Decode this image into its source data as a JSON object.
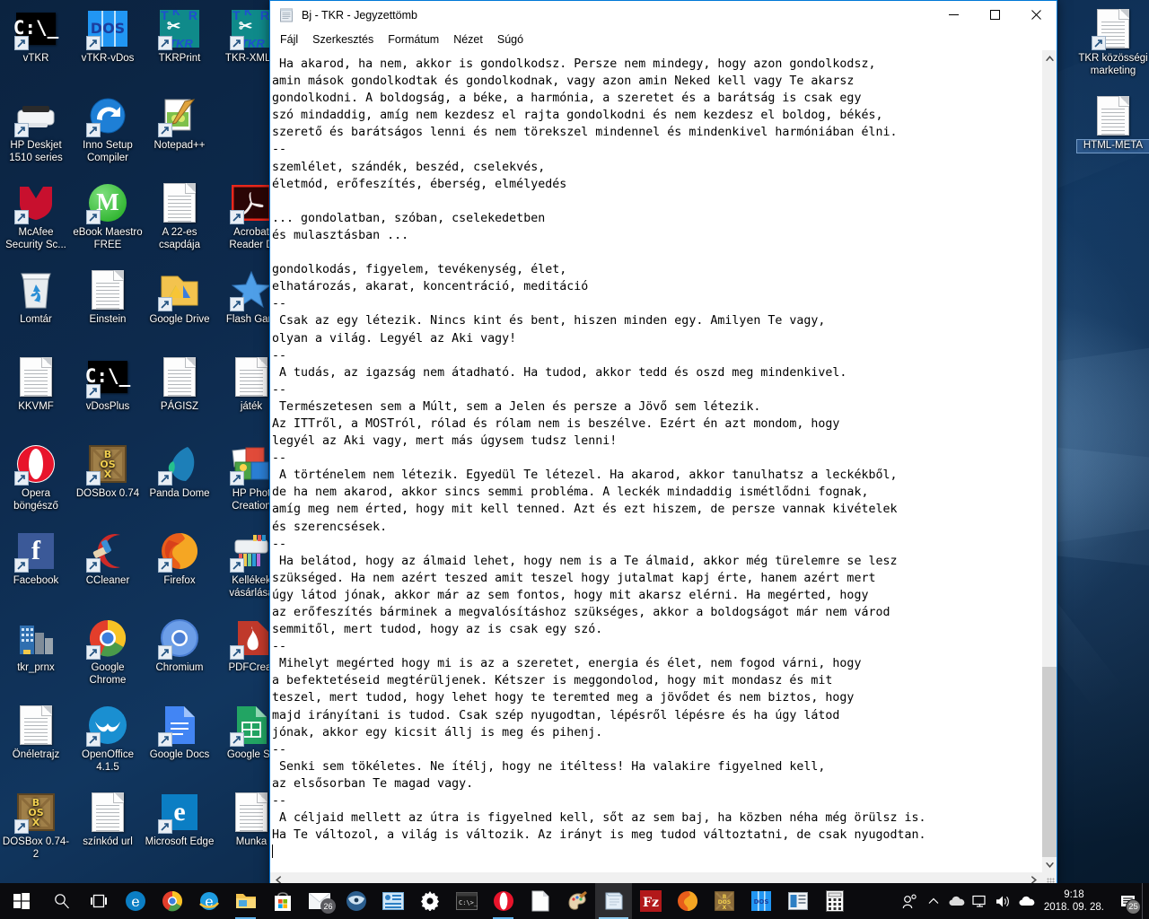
{
  "desktop": {
    "icons": [
      {
        "label": "vTKR",
        "art": "cmd",
        "shortcut": true,
        "col": 0,
        "row": 0
      },
      {
        "label": "vTKR-vDos",
        "art": "dos",
        "shortcut": true,
        "col": 1,
        "row": 0
      },
      {
        "label": "TKRPrint",
        "art": "tkr",
        "shortcut": true,
        "col": 2,
        "row": 0
      },
      {
        "label": "TKR-XMLP",
        "art": "tkr",
        "shortcut": true,
        "col": 3,
        "row": 0
      },
      {
        "label": "HP Deskjet 1510 series",
        "art": "printer",
        "shortcut": true,
        "col": 0,
        "row": 1
      },
      {
        "label": "Inno Setup Compiler",
        "art": "inno",
        "shortcut": true,
        "col": 1,
        "row": 1
      },
      {
        "label": "Notepad++",
        "art": "nppp",
        "shortcut": true,
        "col": 2,
        "row": 1
      },
      {
        "label": "McAfee Security Sc...",
        "art": "mcafee",
        "shortcut": true,
        "col": 0,
        "row": 2
      },
      {
        "label": "eBook Maestro FREE",
        "art": "ebook",
        "shortcut": true,
        "col": 1,
        "row": 2
      },
      {
        "label": "A 22-es csapdája",
        "art": "doc",
        "shortcut": false,
        "col": 2,
        "row": 2
      },
      {
        "label": "Acrobat Reader D",
        "art": "acrobat",
        "shortcut": true,
        "col": 3,
        "row": 2
      },
      {
        "label": "Lomtár",
        "art": "recycle",
        "shortcut": false,
        "col": 0,
        "row": 3
      },
      {
        "label": "Einstein",
        "art": "doc",
        "shortcut": false,
        "col": 1,
        "row": 3
      },
      {
        "label": "Google Drive",
        "art": "gdrive",
        "shortcut": true,
        "col": 2,
        "row": 3
      },
      {
        "label": "Flash Gam",
        "art": "star",
        "shortcut": true,
        "col": 3,
        "row": 3
      },
      {
        "label": "KKVMF",
        "art": "doc",
        "shortcut": false,
        "col": 0,
        "row": 4
      },
      {
        "label": "vDosPlus",
        "art": "cmd",
        "shortcut": true,
        "col": 1,
        "row": 4
      },
      {
        "label": "PÁGISZ",
        "art": "doc",
        "shortcut": false,
        "col": 2,
        "row": 4
      },
      {
        "label": "játék",
        "art": "doc",
        "shortcut": false,
        "col": 3,
        "row": 4
      },
      {
        "label": "Opera böngésző",
        "art": "opera",
        "shortcut": true,
        "col": 0,
        "row": 5
      },
      {
        "label": "DOSBox 0.74",
        "art": "dosbox",
        "shortcut": true,
        "col": 1,
        "row": 5
      },
      {
        "label": "Panda Dome",
        "art": "panda",
        "shortcut": true,
        "col": 2,
        "row": 5
      },
      {
        "label": "HP Phot Creation",
        "art": "hpphoto",
        "shortcut": true,
        "col": 3,
        "row": 5
      },
      {
        "label": "Facebook",
        "art": "facebook",
        "shortcut": true,
        "col": 0,
        "row": 6
      },
      {
        "label": "CCleaner",
        "art": "ccleaner",
        "shortcut": true,
        "col": 1,
        "row": 6
      },
      {
        "label": "Firefox",
        "art": "firefox",
        "shortcut": true,
        "col": 2,
        "row": 6
      },
      {
        "label": "Kellékek vásárlása",
        "art": "hpsupply",
        "shortcut": true,
        "col": 3,
        "row": 6
      },
      {
        "label": "tkr_prnx",
        "art": "city",
        "shortcut": false,
        "col": 0,
        "row": 7
      },
      {
        "label": "Google Chrome",
        "art": "chrome",
        "shortcut": true,
        "col": 1,
        "row": 7
      },
      {
        "label": "Chromium",
        "art": "chromium",
        "shortcut": true,
        "col": 2,
        "row": 7
      },
      {
        "label": "PDFCreat",
        "art": "pdfcreator",
        "shortcut": true,
        "col": 3,
        "row": 7
      },
      {
        "label": "Önéletrajz",
        "art": "doc",
        "shortcut": false,
        "col": 0,
        "row": 8
      },
      {
        "label": "OpenOffice 4.1.5",
        "art": "openoffice",
        "shortcut": true,
        "col": 1,
        "row": 8
      },
      {
        "label": "Google Docs",
        "art": "gdocs",
        "shortcut": true,
        "col": 2,
        "row": 8
      },
      {
        "label": "Google Sh",
        "art": "gsheets",
        "shortcut": true,
        "col": 3,
        "row": 8
      },
      {
        "label": "DOSBox 0.74-2",
        "art": "dosbox",
        "shortcut": true,
        "col": 0,
        "row": 9
      },
      {
        "label": "színkód url",
        "art": "doc",
        "shortcut": false,
        "col": 1,
        "row": 9
      },
      {
        "label": "Microsoft Edge",
        "art": "edge",
        "shortcut": true,
        "col": 2,
        "row": 9
      },
      {
        "label": "Munka",
        "art": "doc",
        "shortcut": false,
        "col": 3,
        "row": 9
      }
    ],
    "right_icons": [
      {
        "label": "TKR közösségi marketing",
        "art": "doc",
        "shortcut": true,
        "selected": false
      },
      {
        "label": "HTML-META",
        "art": "doc",
        "shortcut": false,
        "selected": true
      }
    ]
  },
  "notepad": {
    "title": "Bj - TKR - Jegyzettömb",
    "icon": "notepad-icon",
    "menu": [
      "Fájl",
      "Szerkesztés",
      "Formátum",
      "Nézet",
      "Súgó"
    ],
    "window_buttons": {
      "minimize": "minimize-icon",
      "maximize": "maximize-icon",
      "close": "close-icon"
    },
    "content": " Ha akarod, ha nem, akkor is gondolkodsz. Persze nem mindegy, hogy azon gondolkodsz,\namin mások gondolkodtak és gondolkodnak, vagy azon amin Neked kell vagy Te akarsz\ngondolkodni. A boldogság, a béke, a harmónia, a szeretet és a barátság is csak egy\nszó mindaddig, amíg nem kezdesz el rajta gondolkodni és nem kezdesz el boldog, békés,\nszerető és barátságos lenni és nem törekszel mindennel és mindenkivel harmóniában élni.\n--\nszemlélet, szándék, beszéd, cselekvés,\néletmód, erőfeszítés, éberség, elmélyedés\n\n... gondolatban, szóban, cselekedetben\nés mulasztásban ...\n\ngondolkodás, figyelem, tevékenység, élet,\nelhatározás, akarat, koncentráció, meditáció\n--\n Csak az egy létezik. Nincs kint és bent, hiszen minden egy. Amilyen Te vagy,\nolyan a világ. Legyél az Aki vagy!\n--\n A tudás, az igazság nem átadható. Ha tudod, akkor tedd és oszd meg mindenkivel.\n--\n Természetesen sem a Múlt, sem a Jelen és persze a Jövő sem létezik.\nAz ITTről, a MOSTról, rólad és rólam nem is beszélve. Ezért én azt mondom, hogy\nlegyél az Aki vagy, mert más úgysem tudsz lenni!\n--\n A történelem nem létezik. Egyedül Te létezel. Ha akarod, akkor tanulhatsz a leckékből,\nde ha nem akarod, akkor sincs semmi probléma. A leckék mindaddig ismétlődni fognak,\namíg meg nem érted, hogy mit kell tenned. Azt és ezt hiszem, de persze vannak kivételek\nés szerencsések.\n--\n Ha belátod, hogy az álmaid lehet, hogy nem is a Te álmaid, akkor még türelemre se lesz\nszükséged. Ha nem azért teszed amit teszel hogy jutalmat kapj érte, hanem azért mert\núgy látod jónak, akkor már az sem fontos, hogy mit akarsz elérni. Ha megérted, hogy\naz erőfeszítés bárminek a megvalósításhoz szükséges, akkor a boldogságot már nem várod\nsemmitől, mert tudod, hogy az is csak egy szó.\n--\n Mihelyt megérted hogy mi is az a szeretet, energia és élet, nem fogod várni, hogy\na befektetéseid megtérüljenek. Kétszer is meggondolod, hogy mit mondasz és mit\nteszel, mert tudod, hogy lehet hogy te teremted meg a jövődet és nem biztos, hogy\nmajd irányítani is tudod. Csak szép nyugodtan, lépésről lépésre és ha úgy látod\njónak, akkor egy kicsit állj is meg és pihenj.\n--\n Senki sem tökéletes. Ne ítélj, hogy ne itéltess! Ha valakire figyelned kell,\naz elsősorban Te magad vagy.\n--\n A céljaid mellett az útra is figyelned kell, sőt az sem baj, ha közben néha még örülsz is.\nHa Te változol, a világ is változik. Az irányt is meg tudod változtatni, de csak nyugodtan."
  },
  "taskbar": {
    "start": "windows-start-icon",
    "search": "search-icon",
    "task_view": "task-view-icon",
    "pinned": [
      {
        "name": "microsoft-edge",
        "open": false
      },
      {
        "name": "google-chrome",
        "open": false
      },
      {
        "name": "internet-explorer",
        "open": false
      },
      {
        "name": "file-explorer",
        "open": true
      },
      {
        "name": "microsoft-store",
        "open": false
      },
      {
        "name": "mail",
        "open": false,
        "badge": "26"
      },
      {
        "name": "thunderbird",
        "open": false
      },
      {
        "name": "presentation",
        "open": false
      },
      {
        "name": "settings",
        "open": false
      },
      {
        "name": "command-prompt",
        "open": false
      },
      {
        "name": "opera",
        "open": true
      },
      {
        "name": "notepad-doc",
        "open": false
      },
      {
        "name": "paint",
        "open": false
      },
      {
        "name": "notepad",
        "open": true,
        "active": true
      },
      {
        "name": "filezilla",
        "open": false
      },
      {
        "name": "firefox",
        "open": false
      },
      {
        "name": "dosbox",
        "open": false
      },
      {
        "name": "vdos",
        "open": false
      },
      {
        "name": "windows-app",
        "open": false
      },
      {
        "name": "calculator",
        "open": false
      }
    ],
    "tray": {
      "people": "people-icon",
      "chevron": "show-hidden-icons-icon",
      "onedrive": "onedrive-icon",
      "network": "network-icon",
      "volume": "volume-icon",
      "cloud": "cloud-upload-icon"
    },
    "clock": {
      "time": "9:18",
      "date": "2018. 09. 28."
    },
    "action_center": {
      "icon": "action-center-icon",
      "badge": "25"
    }
  },
  "colors": {
    "accent": "#0078d7",
    "taskbar": "#0b0b0e",
    "desktop": "#0d2a4d",
    "window_bg": "#ffffff",
    "scrollbar_thumb": "#cdcdcd"
  }
}
